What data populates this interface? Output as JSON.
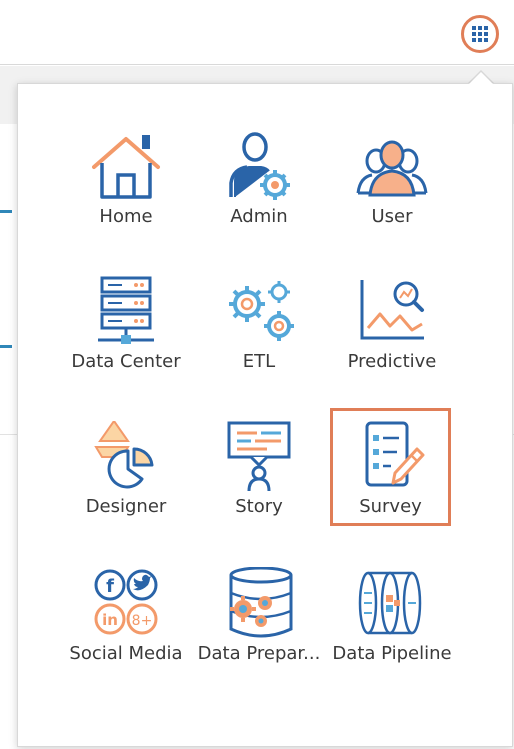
{
  "launcher": {
    "icon": "apps-grid-icon"
  },
  "colors": {
    "accent": "#e07e57",
    "blue": "#2a64a8",
    "lightblue": "#55a8d9",
    "orange": "#f39a6a"
  },
  "menu": {
    "items": [
      {
        "label": "Home",
        "icon": "home-icon"
      },
      {
        "label": "Admin",
        "icon": "admin-icon"
      },
      {
        "label": "User",
        "icon": "user-group-icon"
      },
      {
        "label": "Data Center",
        "icon": "server-rack-icon"
      },
      {
        "label": "ETL",
        "icon": "gears-icon"
      },
      {
        "label": "Predictive",
        "icon": "predictive-chart-icon"
      },
      {
        "label": "Designer",
        "icon": "designer-pie-icon"
      },
      {
        "label": "Story",
        "icon": "story-presenter-icon"
      },
      {
        "label": "Survey",
        "icon": "survey-checklist-icon",
        "selected": true
      },
      {
        "label": "Social Media",
        "icon": "social-media-icon"
      },
      {
        "label": "Data Prepar...",
        "icon": "data-preparation-icon"
      },
      {
        "label": "Data Pipeline",
        "icon": "data-pipeline-icon"
      }
    ]
  }
}
